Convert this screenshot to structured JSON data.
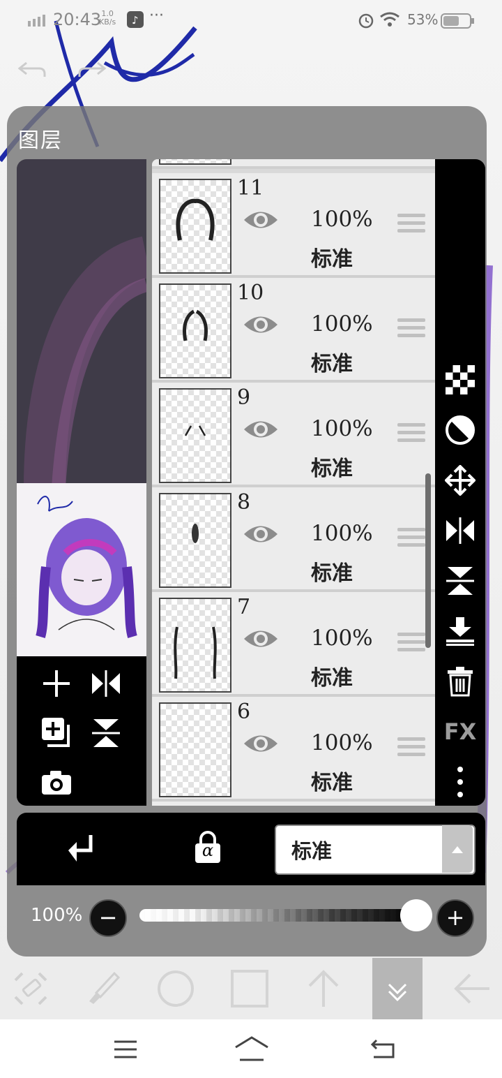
{
  "status_bar": {
    "time": "20:43",
    "net_speed_top": "1.0",
    "net_speed_bottom": "KB/s",
    "more_dots": "···",
    "battery_percent": "53%"
  },
  "panel": {
    "title": "图层"
  },
  "layers": [
    {
      "number": "11",
      "opacity": "100%",
      "mode": "标准"
    },
    {
      "number": "10",
      "opacity": "100%",
      "mode": "标准"
    },
    {
      "number": "9",
      "opacity": "100%",
      "mode": "标准"
    },
    {
      "number": "8",
      "opacity": "100%",
      "mode": "标准"
    },
    {
      "number": "7",
      "opacity": "100%",
      "mode": "标准"
    },
    {
      "number": "6",
      "opacity": "100%",
      "mode": "标准"
    }
  ],
  "right_tools": {
    "fx_label": "FX",
    "items": [
      "transparency-checker-icon",
      "contrast-icon",
      "move-icon",
      "flip-horizontal-icon",
      "flip-vertical-icon",
      "merge-down-icon",
      "trash-icon",
      "fx-icon",
      "more-vertical-icon"
    ]
  },
  "bottom_bar": {
    "blend_mode": "标准",
    "alpha_lock_symbol": "α"
  },
  "opacity_slider": {
    "label": "100%",
    "value": 1.0,
    "minus": "−",
    "plus": "+"
  },
  "colors": {
    "accent_blue": "#1f2aa8",
    "accent_pink": "#c23bbd",
    "panel_bg": "#7a7a7a"
  }
}
